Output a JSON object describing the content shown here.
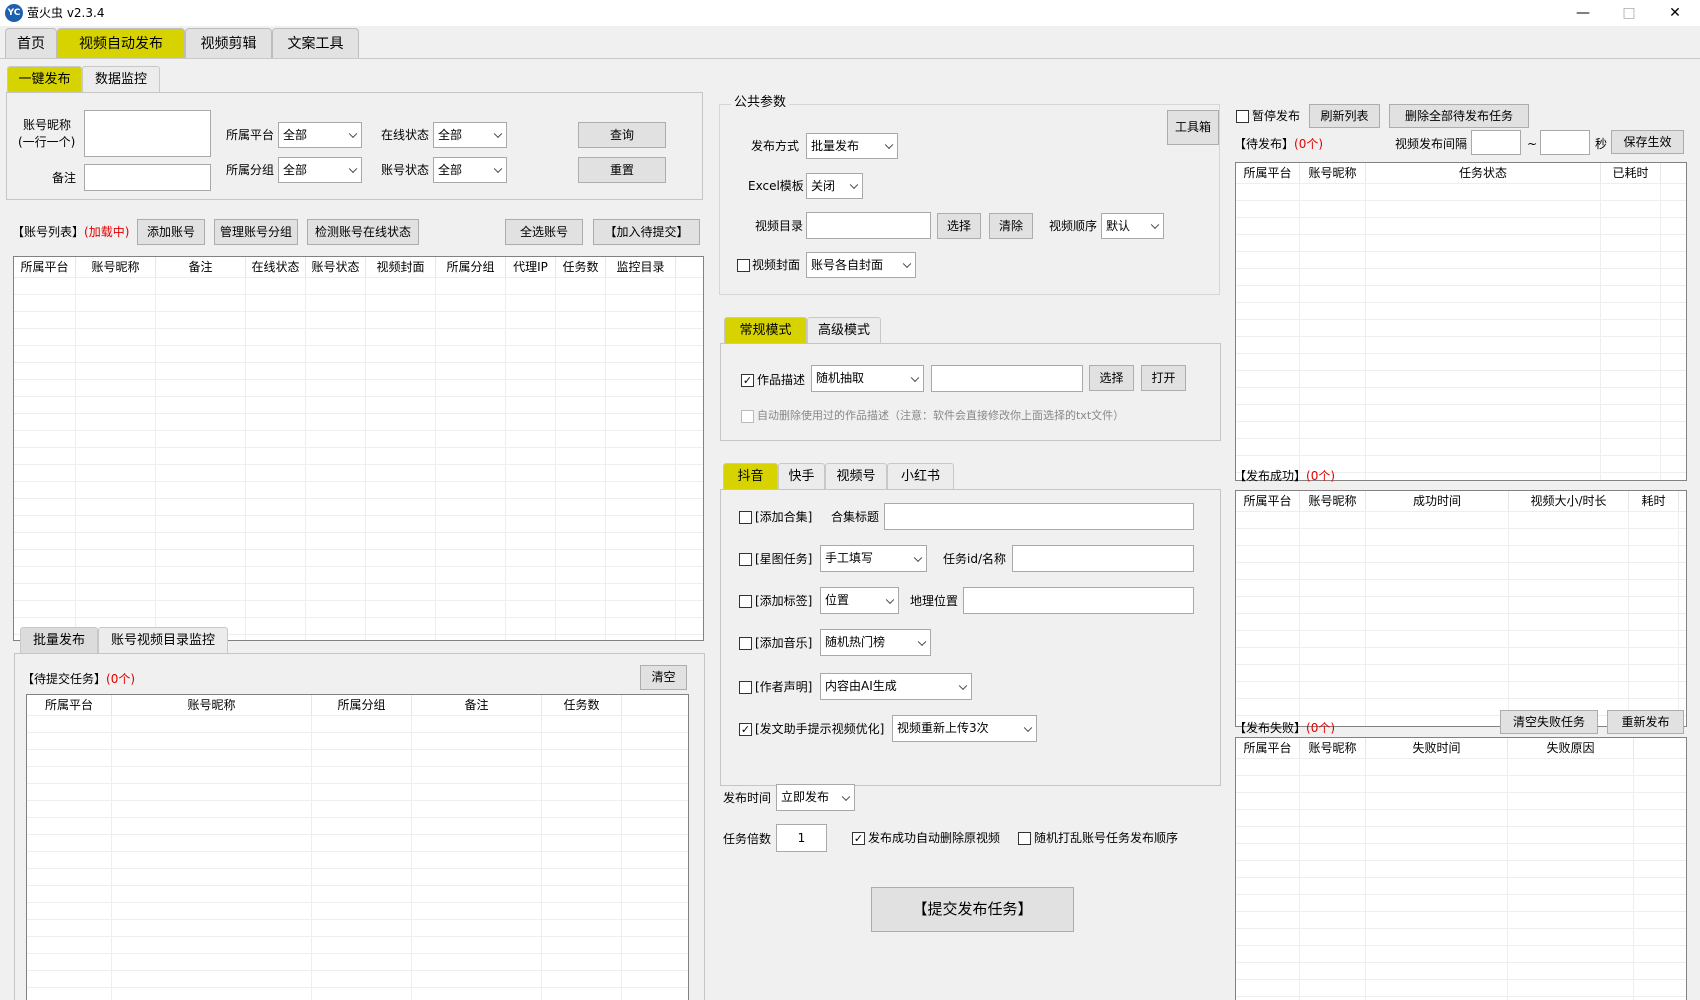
{
  "titlebar": {
    "logo_text": "YC",
    "title": "萤火虫 v2.3.4",
    "min": "—",
    "max": "□",
    "close": "✕"
  },
  "main_tabs": [
    "首页",
    "视频自动发布",
    "视频剪辑",
    "文案工具"
  ],
  "sub_tabs": [
    "一键发布",
    "数据监控"
  ],
  "filter": {
    "nick_label": "账号昵称",
    "nick_label2": "(一行一个)",
    "note_label": "备注",
    "platform_label": "所属平台",
    "platform_value": "全部",
    "group_label": "所属分组",
    "group_value": "全部",
    "online_label": "在线状态",
    "online_value": "全部",
    "status_label": "账号状态",
    "status_value": "全部",
    "query": "查询",
    "reset": "重置"
  },
  "account_list": {
    "title": "【账号列表】",
    "loading": "(加载中)",
    "add": "添加账号",
    "manage": "管理账号分组",
    "check": "检测账号在线状态",
    "select_all": "全选账号",
    "add_pending": "【加入待提交】",
    "columns": [
      "所属平台",
      "账号昵称",
      "备注",
      "在线状态",
      "账号状态",
      "视频封面",
      "所属分组",
      "代理IP",
      "任务数",
      "监控目录"
    ]
  },
  "bottom_tabs": [
    "批量发布",
    "账号视频目录监控"
  ],
  "pending": {
    "title": "【待提交任务】",
    "count": "(0个)",
    "clear": "清空",
    "columns": [
      "所属平台",
      "账号昵称",
      "所属分组",
      "备注",
      "任务数"
    ]
  },
  "common": {
    "title": "公共参数",
    "toolbox": "工具箱",
    "mode_label": "发布方式",
    "mode_value": "批量发布",
    "excel_label": "Excel模板",
    "excel_value": "关闭",
    "dir_label": "视频目录",
    "choose": "选择",
    "clear": "清除",
    "order_label": "视频顺序",
    "order_value": "默认",
    "cover_label": "视频封面",
    "cover_value": "账号各自封面"
  },
  "mode_tabs": [
    "常规模式",
    "高级模式"
  ],
  "desc": {
    "label": "作品描述",
    "value": "随机抽取",
    "choose": "选择",
    "open": "打开",
    "auto_delete": "自动删除使用过的作品描述（注意：软件会直接修改你上面选择的txt文件）"
  },
  "platform_tabs": [
    "抖音",
    "快手",
    "视频号",
    "小红书"
  ],
  "douyin": {
    "collection": "[添加合集]",
    "collection_title": "合集标题",
    "star": "[星图任务]",
    "star_value": "手工填写",
    "task_id": "任务id/名称",
    "tags": "[添加标签]",
    "tags_value": "位置",
    "geo": "地理位置",
    "music": "[添加音乐]",
    "music_value": "随机热门榜",
    "author": "[作者声明]",
    "author_value": "内容由AI生成",
    "assist": "[发文助手提示视频优化]",
    "assist_value": "视频重新上传3次"
  },
  "publish": {
    "time_label": "发布时间",
    "time_value": "立即发布",
    "mult_label": "任务倍数",
    "mult_value": "1",
    "auto_del": "发布成功自动删除原视频",
    "shuffle": "随机打乱账号任务发布顺序",
    "submit": "【提交发布任务】"
  },
  "right": {
    "pause": "暂停发布",
    "refresh": "刷新列表",
    "delete_all": "删除全部待发布任务",
    "pending_title": "【待发布】",
    "pending_count": "(0个)",
    "interval_label": "视频发布间隔",
    "tilde": "~",
    "sec": "秒",
    "save": "保存生效",
    "pending_cols": [
      "所属平台",
      "账号昵称",
      "任务状态",
      "已耗时"
    ],
    "success_title": "【发布成功】",
    "success_count": "(0个)",
    "success_cols": [
      "所属平台",
      "账号昵称",
      "成功时间",
      "视频大小/时长",
      "耗时"
    ],
    "fail_title": "【发布失败】",
    "fail_count": "(0个)",
    "clear_fail": "清空失败任务",
    "republish": "重新发布",
    "fail_cols": [
      "所属平台",
      "账号昵称",
      "失败时间",
      "失败原因"
    ]
  },
  "colors": {
    "accent": "#d7d300",
    "red": "#e00000"
  }
}
